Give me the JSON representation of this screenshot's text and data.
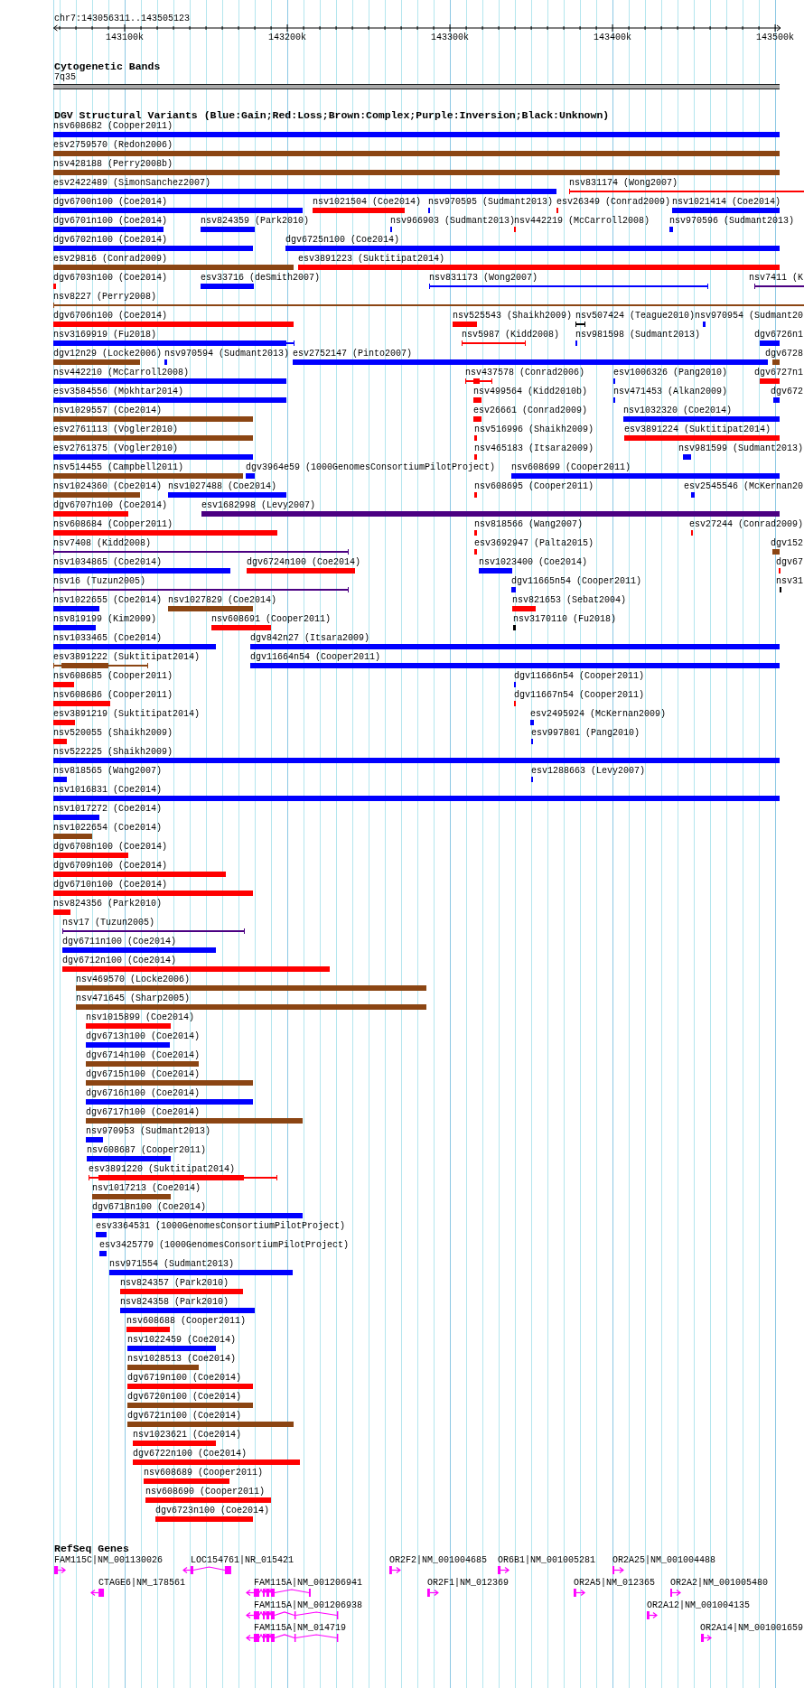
{
  "ruler": {
    "location": "chr7:143056311..143505123",
    "ticks": [
      "143100k",
      "143200k",
      "143300k",
      "143400k",
      "143500k"
    ]
  },
  "cytogenetic_bands": {
    "title": "Cytogenetic Bands",
    "label": "7q35"
  },
  "dgv_track": {
    "title": "DGV Structural Variants (Blue:Gain;Red:Loss;Brown:Complex;Purple:Inversion;Black:Unknown)",
    "rows": [
      [
        {
          "label": "nsv608682 (Cooper2011)",
          "kind": "bar",
          "color": "#0000ff"
        }
      ],
      [
        {
          "label": "esv2759570 (Redon2006)",
          "kind": "bar",
          "color": "#8b4513"
        }
      ],
      [
        {
          "label": "nsv428188 (Perry2008b)",
          "kind": "bar",
          "color": "#8b4513"
        }
      ],
      [
        {
          "label": "esv2422489 (SimonSanchez2007)",
          "kind": "bar",
          "color": "#0000ff"
        },
        {
          "label": "nsv831174 (Wong2007)",
          "kind": "line",
          "color": "#ff0000"
        }
      ],
      [
        {
          "label": "dgv6700n100 (Coe2014)",
          "kind": "bar",
          "color": "#0000ff"
        },
        {
          "label": "nsv1021504 (Coe2014)",
          "kind": "bar",
          "color": "#ff0000"
        },
        {
          "label": "nsv970595 (Sudmant2013)",
          "kind": "bar",
          "color": "#0000ff"
        },
        {
          "label": "esv26349 (Conrad2009)",
          "kind": "bar",
          "color": "#ff0000"
        },
        {
          "label": "nsv1021414 (Coe2014)",
          "kind": "bar",
          "color": "#0000ff"
        }
      ],
      [
        {
          "label": "dgv6701n100 (Coe2014)",
          "kind": "bar",
          "color": "#0000ff"
        },
        {
          "label": "nsv824359 (Park2010)",
          "kind": "bar",
          "color": "#0000ff"
        },
        {
          "label": "nsv966903 (Sudmant2013)",
          "kind": "bar",
          "color": "#0000ff"
        },
        {
          "label": "nsv442219 (McCarroll2008)",
          "kind": "bar",
          "color": "#ff0000"
        },
        {
          "label": "nsv970596 (Sudmant2013)",
          "kind": "bar",
          "color": "#0000ff"
        }
      ],
      [
        {
          "label": "dgv6702n100 (Coe2014)",
          "kind": "bar",
          "color": "#0000ff"
        },
        {
          "label": "dgv6725n100 (Coe2014)",
          "kind": "bar",
          "color": "#0000ff"
        }
      ],
      [
        {
          "label": "esv29816 (Conrad2009)",
          "kind": "bar",
          "color": "#8b4513"
        },
        {
          "label": "esv3891223 (Suktitipat2014)",
          "kind": "bar",
          "color": "#ff0000"
        }
      ],
      [
        {
          "label": "dgv6703n100 (Coe2014)",
          "kind": "bar",
          "color": "#ff0000"
        },
        {
          "label": "esv33716 (deSmith2007)",
          "kind": "bar",
          "color": "#0000ff"
        },
        {
          "label": "nsv831173 (Wong2007)",
          "kind": "line",
          "color": "#0000ff"
        },
        {
          "label": "nsv7411 (K",
          "kind": "line",
          "color": "#4b0082"
        }
      ],
      [
        {
          "label": "nsv8227 (Perry2008)",
          "kind": "line",
          "color": "#8b4513"
        }
      ],
      [
        {
          "label": "dgv6706n100 (Coe2014)",
          "kind": "bar",
          "color": "#ff0000"
        },
        {
          "label": "nsv525543 (Shaikh2009)",
          "kind": "bar",
          "color": "#ff0000"
        },
        {
          "label": "nsv507424 (Teague2010)",
          "kind": "line",
          "color": "#000000"
        },
        {
          "label": "nsv970954 (Sudmant20",
          "kind": "bar",
          "color": "#0000ff"
        }
      ],
      [
        {
          "label": "nsv3169919 (Fu2018)",
          "kind": "whisker",
          "color": "#0000ff"
        },
        {
          "label": "nsv5987 (Kidd2008)",
          "kind": "line",
          "color": "#ff0000"
        },
        {
          "label": "nsv981598 (Sudmant2013)",
          "kind": "bar",
          "color": "#0000ff"
        },
        {
          "label": "dgv6726n1",
          "kind": "bar",
          "color": "#0000ff"
        }
      ],
      [
        {
          "label": "dgv12n29 (Locke2006)",
          "kind": "bar",
          "color": "#8b4513"
        },
        {
          "label": "nsv970594 (Sudmant2013)",
          "kind": "bar",
          "color": "#0000ff"
        },
        {
          "label": "esv2752147 (Pinto2007)",
          "kind": "bar",
          "color": "#0000ff"
        },
        {
          "label": "dgv6728",
          "kind": "bar",
          "color": "#8b4513"
        }
      ],
      [
        {
          "label": "nsv442210 (McCarroll2008)",
          "kind": "bar",
          "color": "#0000ff"
        },
        {
          "label": "nsv437578 (Conrad2006)",
          "kind": "whisker",
          "color": "#ff0000"
        },
        {
          "label": "esv1006326 (Pang2010)",
          "kind": "bar",
          "color": "#0000ff"
        },
        {
          "label": "dgv6727n1",
          "kind": "bar",
          "color": "#ff0000"
        }
      ],
      [
        {
          "label": "esv3584556 (Mokhtar2014)",
          "kind": "bar",
          "color": "#0000ff"
        },
        {
          "label": "nsv499564 (Kidd2010b)",
          "kind": "bar",
          "color": "#ff0000"
        },
        {
          "label": "nsv471453 (Alkan2009)",
          "kind": "bar",
          "color": "#0000ff"
        },
        {
          "label": "dgv672",
          "kind": "bar",
          "color": "#0000ff"
        }
      ],
      [
        {
          "label": "nsv1029557 (Coe2014)",
          "kind": "bar",
          "color": "#8b4513"
        },
        {
          "label": "esv26661 (Conrad2009)",
          "kind": "bar",
          "color": "#ff0000"
        },
        {
          "label": "nsv1032320 (Coe2014)",
          "kind": "bar",
          "color": "#0000ff"
        }
      ],
      [
        {
          "label": "esv2761113 (Vogler2010)",
          "kind": "bar",
          "color": "#8b4513"
        },
        {
          "label": "nsv516996 (Shaikh2009)",
          "kind": "bar",
          "color": "#ff0000"
        },
        {
          "label": "esv3891224 (Suktitipat2014)",
          "kind": "bar",
          "color": "#ff0000"
        }
      ],
      [
        {
          "label": "esv2761375 (Vogler2010)",
          "kind": "bar",
          "color": "#0000ff"
        },
        {
          "label": "nsv465183 (Itsara2009)",
          "kind": "bar",
          "color": "#ff0000"
        },
        {
          "label": "nsv981599 (Sudmant2013)",
          "kind": "bar",
          "color": "#0000ff"
        }
      ],
      [
        {
          "label": "nsv514455 (Campbell2011)",
          "kind": "bar",
          "color": "#8b4513"
        },
        {
          "label": "dgv3964e59 (1000GenomesConsortiumPilotProject)",
          "kind": "bar",
          "color": "#0000ff"
        },
        {
          "label": "nsv608699 (Cooper2011)",
          "kind": "bar",
          "color": "#0000ff"
        }
      ],
      [
        {
          "label": "nsv1024360 (Coe2014)",
          "kind": "bar",
          "color": "#8b4513"
        },
        {
          "label": "nsv1027488 (Coe2014)",
          "kind": "bar",
          "color": "#0000ff"
        },
        {
          "label": "nsv608695 (Cooper2011)",
          "kind": "bar",
          "color": "#ff0000"
        },
        {
          "label": "esv2545546 (McKernan20",
          "kind": "bar",
          "color": "#0000ff"
        }
      ],
      [
        {
          "label": "dgv6707n100 (Coe2014)",
          "kind": "bar",
          "color": "#ff0000"
        },
        {
          "label": "esv1682998 (Levy2007)",
          "kind": "bar",
          "color": "#4b0082"
        }
      ],
      [
        {
          "label": "nsv608684 (Cooper2011)",
          "kind": "bar",
          "color": "#ff0000"
        },
        {
          "label": "nsv818566 (Wang2007)",
          "kind": "bar",
          "color": "#ff0000"
        },
        {
          "label": "esv27244 (Conrad2009)",
          "kind": "bar",
          "color": "#ff0000"
        }
      ],
      [
        {
          "label": "nsv7408 (Kidd2008)",
          "kind": "line",
          "color": "#4b0082"
        },
        {
          "label": "esv3692947 (Palta2015)",
          "kind": "bar",
          "color": "#ff0000"
        },
        {
          "label": "dgv152",
          "kind": "bar",
          "color": "#8b4513"
        }
      ],
      [
        {
          "label": "nsv1034865 (Coe2014)",
          "kind": "bar",
          "color": "#0000ff"
        },
        {
          "label": "dgv6724n100 (Coe2014)",
          "kind": "bar",
          "color": "#ff0000"
        },
        {
          "label": "nsv1023400 (Coe2014)",
          "kind": "bar",
          "color": "#0000ff"
        },
        {
          "label": "dgv67",
          "kind": "bar",
          "color": "#ff0000"
        }
      ],
      [
        {
          "label": "nsv16 (Tuzun2005)",
          "kind": "line",
          "color": "#4b0082"
        },
        {
          "label": "dgv11665n54 (Cooper2011)",
          "kind": "bar",
          "color": "#0000ff"
        },
        {
          "label": "nsv31",
          "kind": "bar",
          "color": "#000000"
        }
      ],
      [
        {
          "label": "nsv1022655 (Coe2014)",
          "kind": "bar",
          "color": "#0000ff"
        },
        {
          "label": "nsv1027829 (Coe2014)",
          "kind": "bar",
          "color": "#8b4513"
        },
        {
          "label": "nsv821653 (Sebat2004)",
          "kind": "bar",
          "color": "#ff0000"
        }
      ],
      [
        {
          "label": "nsv819199 (Kim2009)",
          "kind": "bar",
          "color": "#0000ff"
        },
        {
          "label": "nsv608691 (Cooper2011)",
          "kind": "bar",
          "color": "#ff0000"
        },
        {
          "label": "nsv3170110 (Fu2018)",
          "kind": "bar",
          "color": "#000000"
        }
      ],
      [
        {
          "label": "nsv1033465 (Coe2014)",
          "kind": "bar",
          "color": "#0000ff"
        },
        {
          "label": "dgv842n27 (Itsara2009)",
          "kind": "bar",
          "color": "#0000ff"
        }
      ],
      [
        {
          "label": "esv3891222 (Suktitipat2014)",
          "kind": "whisker",
          "color": "#8b4513"
        },
        {
          "label": "dgv11664n54 (Cooper2011)",
          "kind": "bar",
          "color": "#0000ff"
        }
      ],
      [
        {
          "label": "nsv608685 (Cooper2011)",
          "kind": "bar",
          "color": "#ff0000"
        },
        {
          "label": "dgv11666n54 (Cooper2011)",
          "kind": "bar",
          "color": "#0000ff"
        }
      ],
      [
        {
          "label": "nsv608686 (Cooper2011)",
          "kind": "bar",
          "color": "#ff0000"
        },
        {
          "label": "dgv11667n54 (Cooper2011)",
          "kind": "bar",
          "color": "#ff0000"
        }
      ],
      [
        {
          "label": "esv3891219 (Suktitipat2014)",
          "kind": "bar",
          "color": "#ff0000"
        },
        {
          "label": "esv2495924 (McKernan2009)",
          "kind": "bar",
          "color": "#0000ff"
        }
      ],
      [
        {
          "label": "nsv520055 (Shaikh2009)",
          "kind": "bar",
          "color": "#ff0000"
        },
        {
          "label": "esv997801 (Pang2010)",
          "kind": "bar",
          "color": "#0000ff"
        }
      ],
      [
        {
          "label": "nsv522225 (Shaikh2009)",
          "kind": "bar",
          "color": "#0000ff"
        }
      ],
      [
        {
          "label": "nsv818565 (Wang2007)",
          "kind": "bar",
          "color": "#0000ff"
        },
        {
          "label": "esv1288663 (Levy2007)",
          "kind": "bar",
          "color": "#0000ff"
        }
      ],
      [
        {
          "label": "nsv1016831 (Coe2014)",
          "kind": "bar",
          "color": "#0000ff"
        }
      ],
      [
        {
          "label": "nsv1017272 (Coe2014)",
          "kind": "bar",
          "color": "#0000ff"
        }
      ],
      [
        {
          "label": "nsv1022654 (Coe2014)",
          "kind": "bar",
          "color": "#8b4513"
        }
      ],
      [
        {
          "label": "dgv6708n100 (Coe2014)",
          "kind": "bar",
          "color": "#ff0000"
        }
      ],
      [
        {
          "label": "dgv6709n100 (Coe2014)",
          "kind": "bar",
          "color": "#ff0000"
        }
      ],
      [
        {
          "label": "dgv6710n100 (Coe2014)",
          "kind": "bar",
          "color": "#ff0000"
        }
      ],
      [
        {
          "label": "nsv824356 (Park2010)",
          "kind": "bar",
          "color": "#ff0000"
        }
      ],
      [
        {
          "label": "nsv17 (Tuzun2005)",
          "kind": "line",
          "color": "#4b0082"
        }
      ],
      [
        {
          "label": "dgv6711n100 (Coe2014)",
          "kind": "bar",
          "color": "#0000ff"
        }
      ],
      [
        {
          "label": "dgv6712n100 (Coe2014)",
          "kind": "bar",
          "color": "#ff0000"
        }
      ],
      [
        {
          "label": "nsv469570 (Locke2006)",
          "kind": "bar",
          "color": "#8b4513"
        }
      ],
      [
        {
          "label": "nsv471645 (Sharp2005)",
          "kind": "bar",
          "color": "#8b4513"
        }
      ],
      [
        {
          "label": "nsv1015899 (Coe2014)",
          "kind": "bar",
          "color": "#ff0000"
        }
      ],
      [
        {
          "label": "dgv6713n100 (Coe2014)",
          "kind": "bar",
          "color": "#0000ff"
        }
      ],
      [
        {
          "label": "dgv6714n100 (Coe2014)",
          "kind": "bar",
          "color": "#8b4513"
        }
      ],
      [
        {
          "label": "dgv6715n100 (Coe2014)",
          "kind": "bar",
          "color": "#8b4513"
        }
      ],
      [
        {
          "label": "dgv6716n100 (Coe2014)",
          "kind": "bar",
          "color": "#0000ff"
        }
      ],
      [
        {
          "label": "dgv6717n100 (Coe2014)",
          "kind": "bar",
          "color": "#8b4513"
        }
      ],
      [
        {
          "label": "nsv970953 (Sudmant2013)",
          "kind": "bar",
          "color": "#0000ff"
        }
      ],
      [
        {
          "label": "nsv608687 (Cooper2011)",
          "kind": "bar",
          "color": "#0000ff"
        }
      ],
      [
        {
          "label": "esv3891220 (Suktitipat2014)",
          "kind": "whisker",
          "color": "#ff0000"
        }
      ],
      [
        {
          "label": "nsv1017213 (Coe2014)",
          "kind": "bar",
          "color": "#8b4513"
        }
      ],
      [
        {
          "label": "dgv6718n100 (Coe2014)",
          "kind": "bar",
          "color": "#0000ff"
        }
      ],
      [
        {
          "label": "esv3364531 (1000GenomesConsortiumPilotProject)",
          "kind": "bar",
          "color": "#0000ff"
        }
      ],
      [
        {
          "label": "esv3425779 (1000GenomesConsortiumPilotProject)",
          "kind": "bar",
          "color": "#0000ff"
        }
      ],
      [
        {
          "label": "nsv971554 (Sudmant2013)",
          "kind": "bar",
          "color": "#0000ff"
        }
      ],
      [
        {
          "label": "nsv824357 (Park2010)",
          "kind": "bar",
          "color": "#ff0000"
        }
      ],
      [
        {
          "label": "nsv824358 (Park2010)",
          "kind": "bar",
          "color": "#0000ff"
        }
      ],
      [
        {
          "label": "nsv608688 (Cooper2011)",
          "kind": "bar",
          "color": "#ff0000"
        }
      ],
      [
        {
          "label": "nsv1022459 (Coe2014)",
          "kind": "bar",
          "color": "#0000ff"
        }
      ],
      [
        {
          "label": "nsv1028513 (Coe2014)",
          "kind": "bar",
          "color": "#8b4513"
        }
      ],
      [
        {
          "label": "dgv6719n100 (Coe2014)",
          "kind": "bar",
          "color": "#ff0000"
        }
      ],
      [
        {
          "label": "dgv6720n100 (Coe2014)",
          "kind": "bar",
          "color": "#8b4513"
        }
      ],
      [
        {
          "label": "dgv6721n100 (Coe2014)",
          "kind": "bar",
          "color": "#8b4513"
        }
      ],
      [
        {
          "label": "nsv1023621 (Coe2014)",
          "kind": "bar",
          "color": "#ff0000"
        }
      ],
      [
        {
          "label": "dgv6722n100 (Coe2014)",
          "kind": "bar",
          "color": "#ff0000"
        }
      ],
      [
        {
          "label": "nsv608689 (Cooper2011)",
          "kind": "bar",
          "color": "#ff0000"
        }
      ],
      [
        {
          "label": "nsv608690 (Cooper2011)",
          "kind": "bar",
          "color": "#ff0000"
        }
      ],
      [
        {
          "label": "dgv6723n100 (Coe2014)",
          "kind": "bar",
          "color": "#ff0000"
        }
      ]
    ]
  },
  "refseq_genes": {
    "title": "RefSeq Genes",
    "rows": [
      [
        {
          "label": "FAM115C|NM_001130026",
          "reverse_strand": false
        },
        {
          "label": "LOC154761|NR_015421",
          "reverse_strand": true
        },
        {
          "label": "OR2F2|NM_001004685",
          "reverse_strand": false
        },
        {
          "label": "OR6B1|NM_001005281",
          "reverse_strand": false
        },
        {
          "label": "OR2A25|NM_001004488",
          "reverse_strand": false
        }
      ],
      [
        {
          "label": "CTAGE6|NM_178561",
          "reverse_strand": true
        },
        {
          "label": "FAM115A|NM_001206941",
          "reverse_strand": true
        },
        {
          "label": "OR2F1|NM_012369",
          "reverse_strand": false
        },
        {
          "label": "OR2A5|NM_012365",
          "reverse_strand": false
        },
        {
          "label": "OR2A2|NM_001005480",
          "reverse_strand": false
        }
      ],
      [
        {
          "label": "FAM115A|NM_001206938",
          "reverse_strand": true
        },
        {
          "label": "OR2A12|NM_001004135",
          "reverse_strand": false
        }
      ],
      [
        {
          "label": "FAM115A|NM_014719",
          "reverse_strand": true
        },
        {
          "label": "OR2A14|NM_001001659",
          "reverse_strand": false
        }
      ]
    ]
  }
}
